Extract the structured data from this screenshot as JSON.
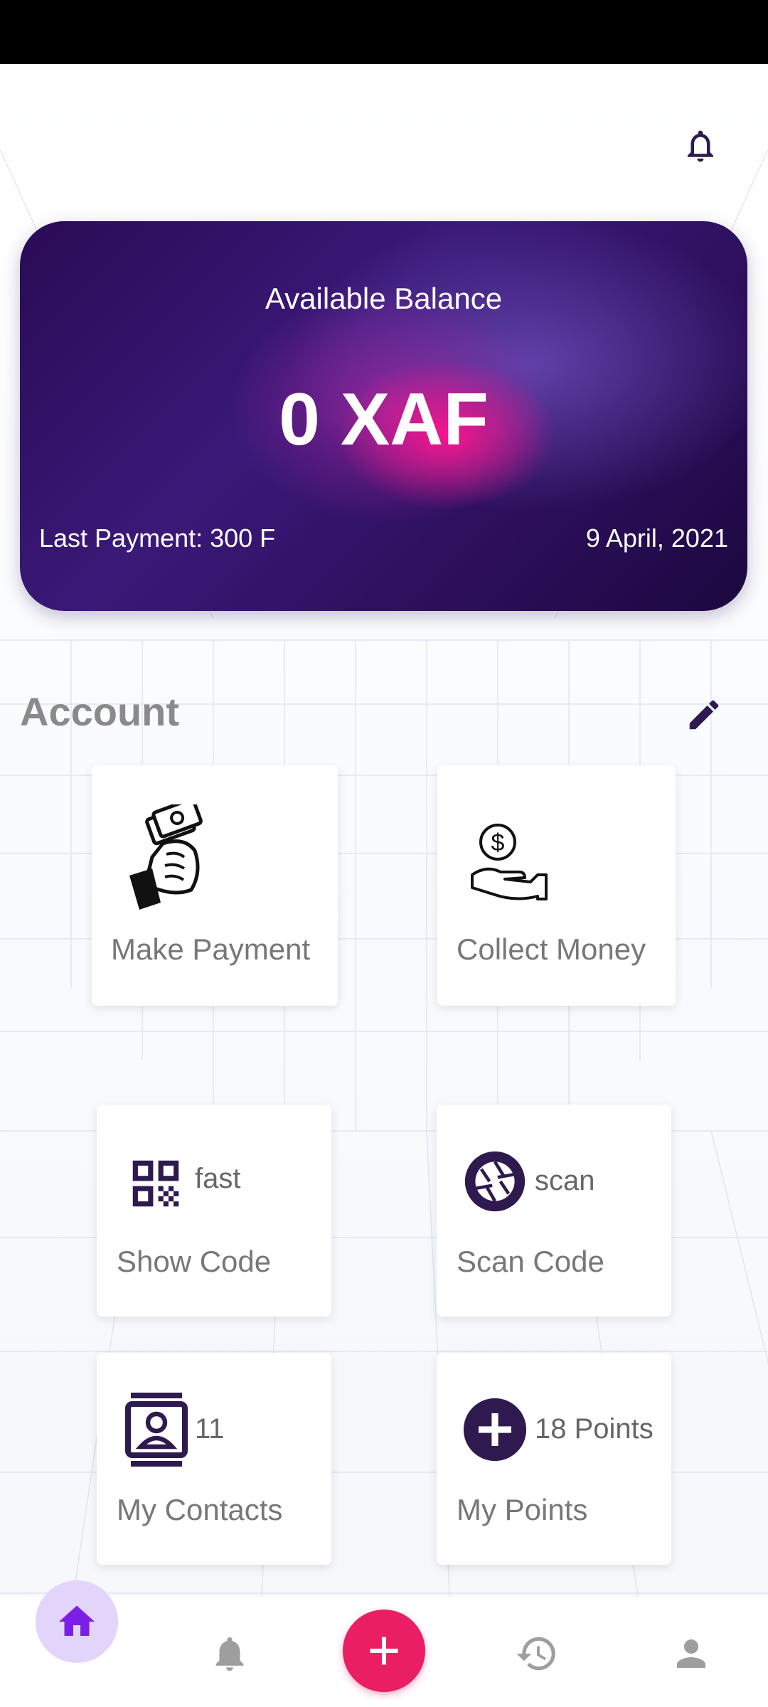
{
  "balance_card": {
    "label": "Available Balance",
    "amount": "0 XAF",
    "last_payment": "Last Payment: 300 F",
    "date": "9 April, 2021"
  },
  "account": {
    "title": "Account"
  },
  "tiles": {
    "make_payment": {
      "label": "Make Payment"
    },
    "collect_money": {
      "label": "Collect Money",
      "icon_symbol": "$"
    },
    "show_code": {
      "label": "Show Code",
      "badge": "fast"
    },
    "scan_code": {
      "label": "Scan Code",
      "badge": "scan"
    },
    "my_contacts": {
      "label": "My Contacts",
      "badge": "11"
    },
    "my_points": {
      "label": "My Points",
      "badge": "18 Points"
    }
  },
  "nav": {
    "items": [
      "home-icon",
      "bell-icon",
      "add-icon",
      "history-icon",
      "person-icon"
    ]
  },
  "colors": {
    "accent": "#e91e63",
    "primary_dark": "#2e1a4f",
    "home_active": "#7b1fe8",
    "nav_inactive": "#9e9e9e"
  }
}
